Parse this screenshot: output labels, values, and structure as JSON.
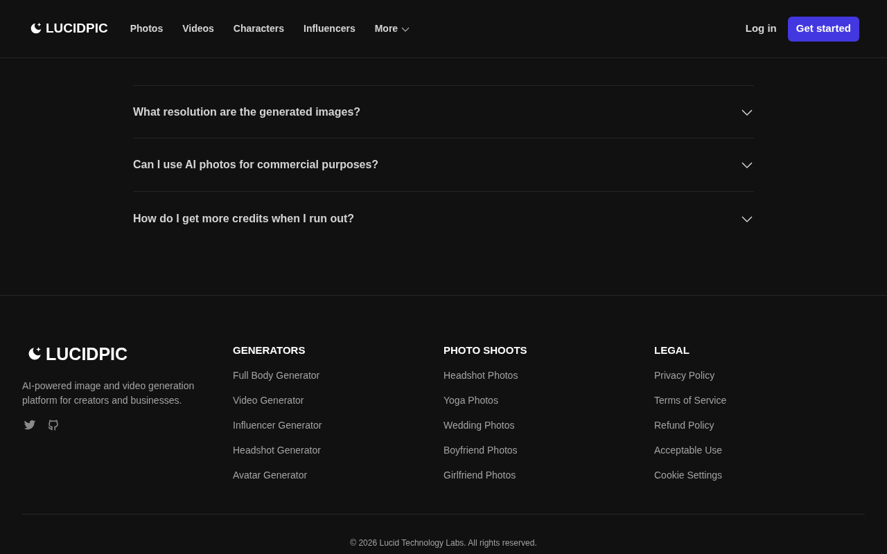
{
  "header": {
    "logo": "LUCIDPIC",
    "nav": [
      {
        "label": "Photos",
        "dropdown": false
      },
      {
        "label": "Videos",
        "dropdown": false
      },
      {
        "label": "Characters",
        "dropdown": false
      },
      {
        "label": "Influencers",
        "dropdown": false
      },
      {
        "label": "More",
        "dropdown": true
      }
    ],
    "login": "Log in",
    "cta": "Get started"
  },
  "faq": [
    {
      "question": "What resolution are the generated images?",
      "expanded": false
    },
    {
      "question": "Can I use AI photos for commercial purposes?",
      "expanded": false
    },
    {
      "question": "How do I get more credits when I run out?",
      "expanded": false
    }
  ],
  "footer": {
    "logo": "LUCIDPIC",
    "tagline": "AI-powered image and video generation platform for creators and businesses.",
    "columns": [
      {
        "heading": "GENERATORS",
        "links": [
          "Full Body Generator",
          "Video Generator",
          "Influencer Generator",
          "Headshot Generator",
          "Avatar Generator"
        ]
      },
      {
        "heading": "PHOTO SHOOTS",
        "links": [
          "Headshot Photos",
          "Yoga Photos",
          "Wedding Photos",
          "Boyfriend Photos",
          "Girlfriend Photos"
        ]
      },
      {
        "heading": "LEGAL",
        "links": [
          "Privacy Policy",
          "Terms of Service",
          "Refund Policy",
          "Acceptable Use",
          "Cookie Settings"
        ]
      }
    ],
    "copyright": "© 2026 Lucid Technology Labs. All rights reserved."
  }
}
